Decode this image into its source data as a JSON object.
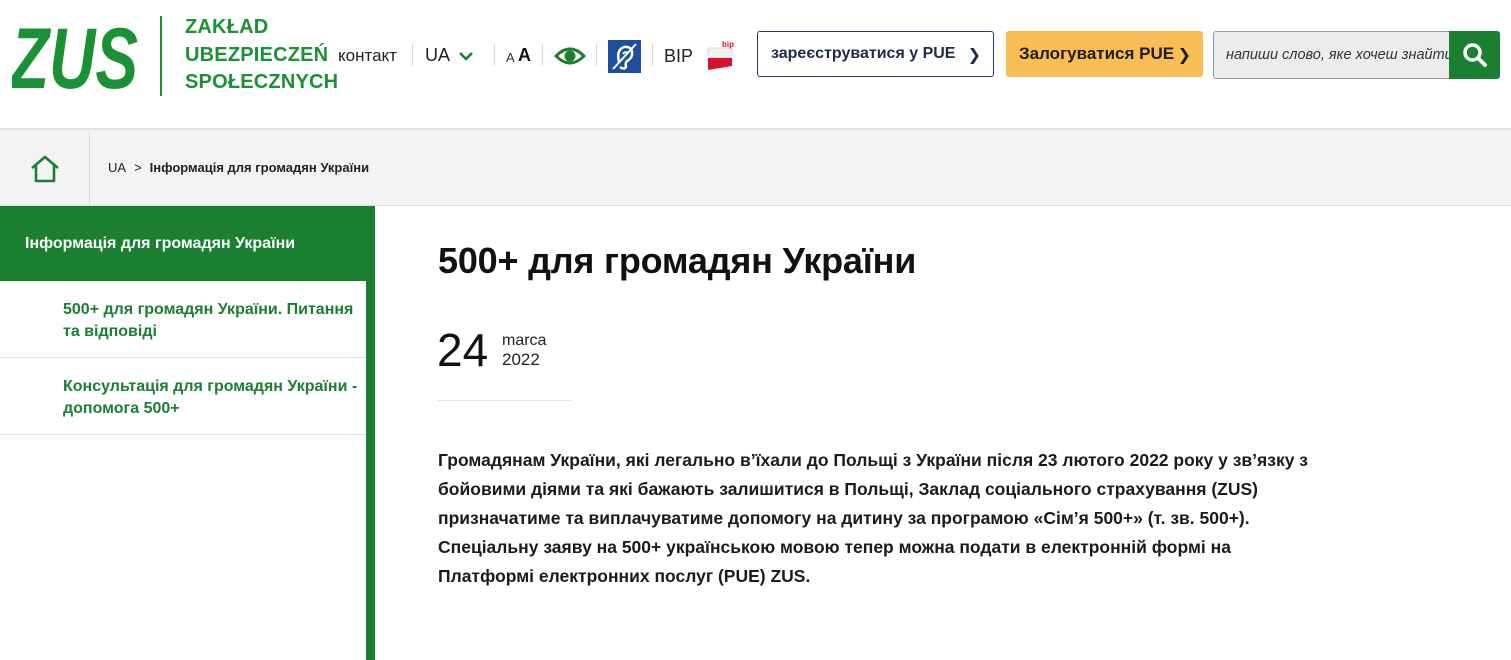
{
  "header": {
    "logo_text": "ZUS",
    "org_name": "ZAKŁAD UBEZPIECZEŃ SPOŁECZNYCH",
    "contact_label": "контакт",
    "lang_label": "UA",
    "font_small_label": "A",
    "font_big_label": "A",
    "bip_label": "BIP",
    "bip_flag_text": "bip",
    "register_label": "зареєструватися у PUE",
    "login_label": "Залогуватися PUE",
    "search_placeholder": "напиши слово, яке хочеш знайти",
    "icons": [
      "chevron-down-icon",
      "eye-icon",
      "hearing-icon",
      "bip-flag-icon",
      "chevron-right-icon",
      "search-icon"
    ]
  },
  "breadcrumb": {
    "items": [
      "UA",
      "Інформація для громадян України"
    ],
    "separator": ">"
  },
  "sidebar": {
    "active_label": "Інформація для громадян України",
    "items": [
      {
        "label": "500+ для громадян України. Питання та відповіді"
      },
      {
        "label": "Консультація для громадян України - допомога 500+"
      }
    ]
  },
  "article": {
    "title": "500+ для громадян України",
    "date_day": "24",
    "date_month": "marca",
    "date_year": "2022",
    "lead": "Громадянам України, які легально в’їхали до Польщі з України після 23 лютого 2022 року у зв’язку з бойовими діями та які бажають залишитися в Польщі, Заклад соціального страхування (ZUS) призначатиме та виплачуватиме допомогу на дитину за програмою «Сім’я 500+» (т. зв. 500+). Спеціальну заяву на 500+ українською мовою тепер можна подати в електронній формі на Платформі електронних послуг (PUE) ZUS."
  },
  "colors": {
    "brand_green": "#1a7f30",
    "logo_green": "#1a9134",
    "login_orange": "#f8bd55",
    "register_border": "#2a3a5a"
  }
}
